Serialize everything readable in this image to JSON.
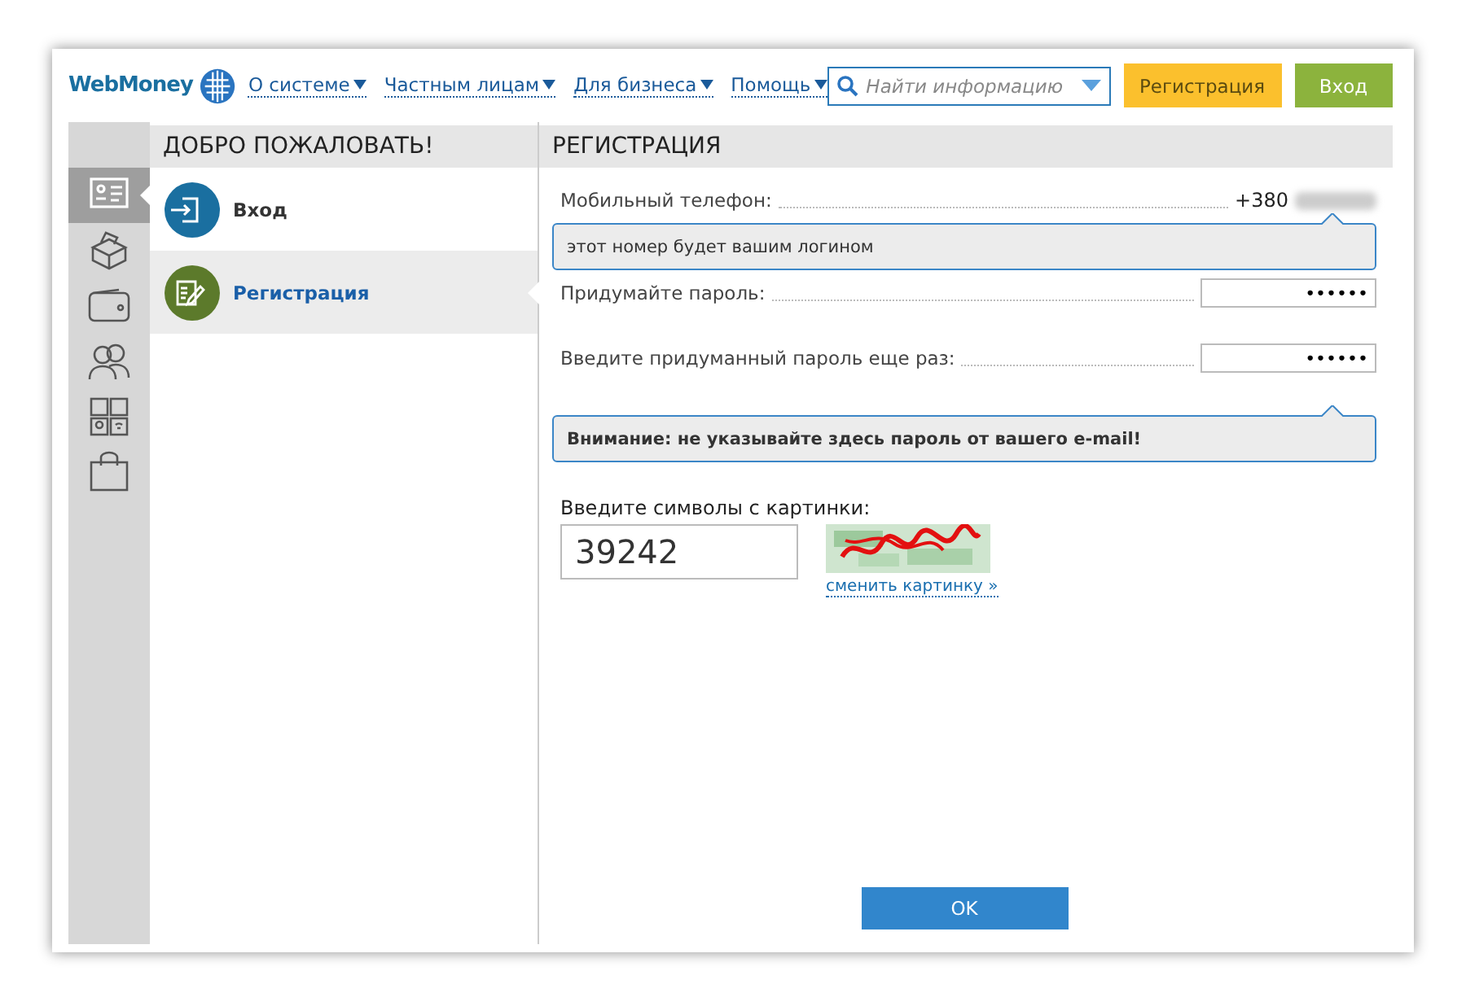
{
  "header": {
    "logo": "WebMoney",
    "nav": [
      {
        "label": "О системе"
      },
      {
        "label": "Частным лицам"
      },
      {
        "label": "Для бизнеса"
      },
      {
        "label": "Помощь"
      }
    ],
    "search": {
      "placeholder": "Найти информацию"
    },
    "buttons": [
      {
        "label": "Регистрация",
        "kind": "register"
      },
      {
        "label": "Вход",
        "kind": "login"
      }
    ]
  },
  "sidebar": {
    "icons": [
      {
        "kind": "id-card",
        "selected": true
      },
      {
        "kind": "box",
        "selected": false
      },
      {
        "kind": "wallet",
        "selected": false
      },
      {
        "kind": "people",
        "selected": false
      },
      {
        "kind": "services",
        "selected": false
      },
      {
        "kind": "bag",
        "selected": false
      }
    ]
  },
  "menu": {
    "title": "ДОБРО ПОЖАЛОВАТЬ!",
    "items": [
      {
        "label": "Вход",
        "kind": "login",
        "selected": false
      },
      {
        "label": "Регистрация",
        "kind": "register",
        "selected": true
      }
    ]
  },
  "form": {
    "title": "РЕГИСТРАЦИЯ",
    "phone": {
      "label": "Мобильный телефон:",
      "value": "+380"
    },
    "phone_hint": "этот номер будет вашим логином",
    "password": {
      "label": "Придумайте пароль:",
      "value": "••••••"
    },
    "password_repeat": {
      "label": "Введите придуманный пароль еще раз:",
      "value": "••••••"
    },
    "warning": "Внимание: не указывайте здесь пароль от вашего e-mail!",
    "captcha": {
      "label": "Введите символы с картинки:",
      "value": "39242",
      "change_link": "сменить картинку »"
    },
    "submit": "OK"
  }
}
